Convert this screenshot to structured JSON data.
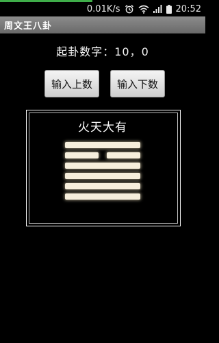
{
  "status_bar": {
    "speed": "0.01K/s",
    "time": "20:52",
    "progress": 0.45,
    "icons": [
      "alarm-clock-icon",
      "wifi-icon",
      "signal-icon",
      "battery-icon"
    ]
  },
  "app": {
    "title": "周文王八卦"
  },
  "summary": {
    "text": "起卦数字：10，0"
  },
  "buttons": {
    "upper_label": "输入上数",
    "lower_label": "输入下数"
  },
  "hexagram": {
    "name": "火天大有",
    "lines_top_to_bottom": [
      "yang",
      "yin",
      "yang",
      "yang",
      "yang",
      "yang"
    ]
  },
  "colors": {
    "background": "#000000",
    "title_bar": "#7a7a7a",
    "line_glow": "#f6eedc",
    "progress": "#3fae4a"
  }
}
